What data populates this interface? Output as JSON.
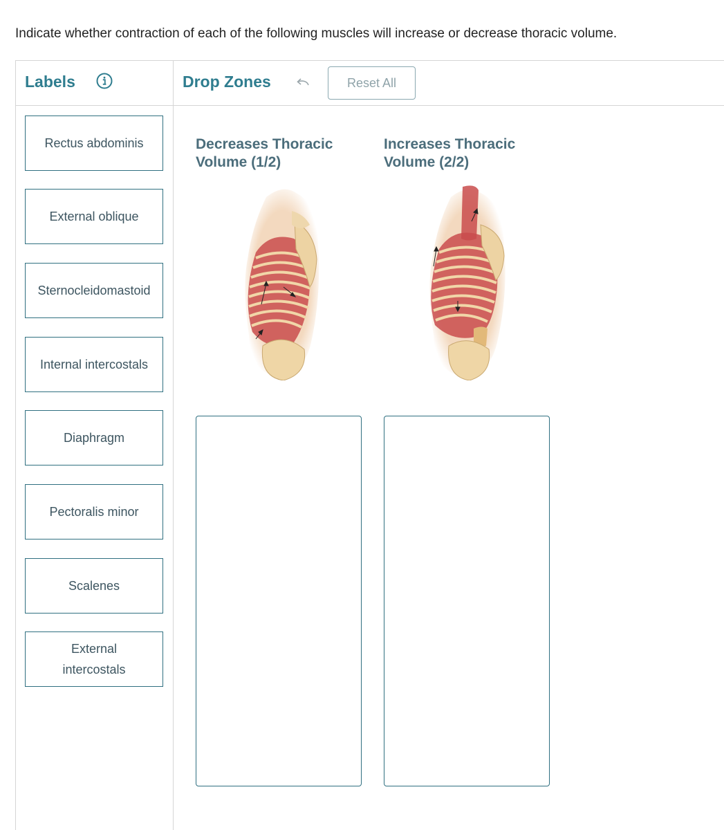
{
  "instructions": "Indicate whether contraction of each of the following muscles will increase or decrease thoracic volume.",
  "labels_panel": {
    "title": "Labels",
    "info_icon": "info-circle-icon",
    "items": [
      {
        "label": "Rectus abdominis"
      },
      {
        "label": "External oblique"
      },
      {
        "label": "Sternocleidomastoid"
      },
      {
        "label": "Internal intercostals"
      },
      {
        "label": "Diaphragm"
      },
      {
        "label": "Pectoralis minor"
      },
      {
        "label": "Scalenes"
      },
      {
        "label": "External intercostals"
      }
    ]
  },
  "drop_zones_panel": {
    "title": "Drop Zones",
    "undo_icon": "undo-arrow-icon",
    "reset_label": "Reset All",
    "zones": [
      {
        "title": "Decreases Thoracic Volume (1/2)"
      },
      {
        "title": "Increases Thoracic Volume (2/2)"
      }
    ]
  },
  "colors": {
    "accent": "#2f7d8f",
    "card_border": "#2f6f80",
    "zone_title": "#4b6d7b",
    "divider": "#d5d5d5"
  }
}
